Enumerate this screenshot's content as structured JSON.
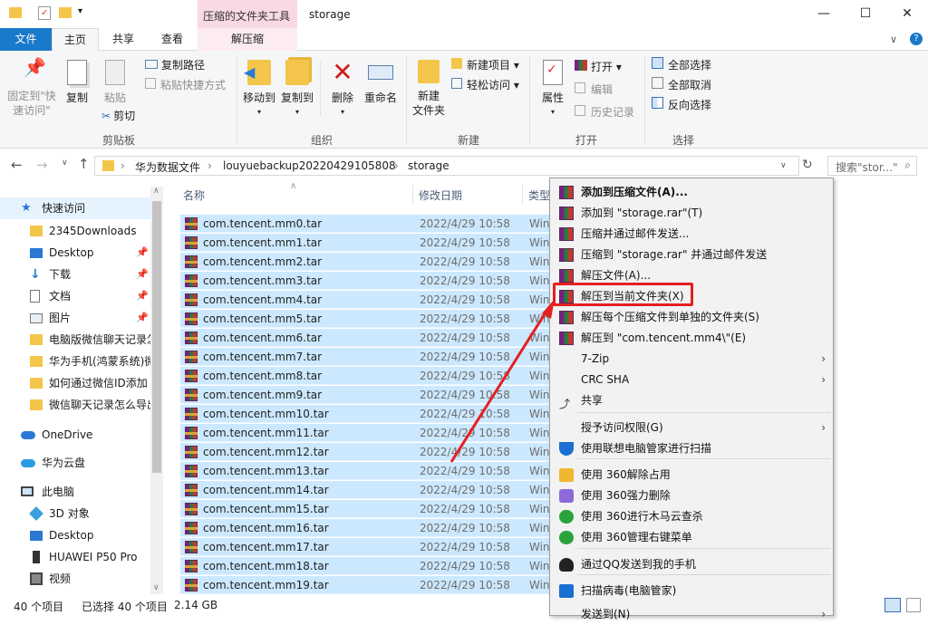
{
  "titlebar": {
    "context_tab": "压缩的文件夹工具",
    "title": "storage"
  },
  "tabs": {
    "file": "文件",
    "home": "主页",
    "share": "共享",
    "view": "查看",
    "extract": "解压缩"
  },
  "ribbon": {
    "pin": "固定到\"快速访问\"",
    "copy": "复制",
    "paste": "粘贴",
    "copy_path": "复制路径",
    "paste_shortcut": "粘贴快捷方式",
    "cut": "剪切",
    "clipboard": "剪贴板",
    "move_to": "移动到",
    "copy_to": "复制到",
    "delete": "删除",
    "rename": "重命名",
    "organize": "组织",
    "new_folder_1": "新建",
    "new_folder_2": "文件夹",
    "new_item": "新建项目",
    "easy_access": "轻松访问",
    "new": "新建",
    "properties": "属性",
    "open": "打开",
    "edit": "编辑",
    "history": "历史记录",
    "open_group": "打开",
    "select_all": "全部选择",
    "select_none": "全部取消",
    "invert": "反向选择",
    "select": "选择"
  },
  "address": {
    "crumbs": [
      "华为数据文件",
      "louyuebackup20220429105808",
      "storage"
    ],
    "search_placeholder": "搜索\"stor...\""
  },
  "nav": {
    "items": [
      {
        "label": "快速访问",
        "icon": "star-icon"
      },
      {
        "label": "2345Downloads",
        "icon": "folder-icon"
      },
      {
        "label": "Desktop",
        "icon": "desktop-icon"
      },
      {
        "label": "下载",
        "icon": "download-icon"
      },
      {
        "label": "文档",
        "icon": "document-icon"
      },
      {
        "label": "图片",
        "icon": "picture-icon"
      },
      {
        "label": "电脑版微信聊天记录怎",
        "icon": "folder-icon"
      },
      {
        "label": "华为手机(鸿蒙系统)微",
        "icon": "folder-icon"
      },
      {
        "label": "如何通过微信ID添加",
        "icon": "folder-icon"
      },
      {
        "label": "微信聊天记录怎么导出",
        "icon": "folder-icon"
      },
      {
        "label": "OneDrive",
        "icon": "cloud-icon"
      },
      {
        "label": "华为云盘",
        "icon": "huawei-cloud-icon"
      },
      {
        "label": "此电脑",
        "icon": "computer-icon"
      },
      {
        "label": "3D 对象",
        "icon": "cube-icon"
      },
      {
        "label": "Desktop",
        "icon": "desktop-icon"
      },
      {
        "label": "HUAWEI P50 Pro",
        "icon": "phone-icon"
      },
      {
        "label": "视频",
        "icon": "video-icon"
      }
    ]
  },
  "columns": {
    "name": "名称",
    "date": "修改日期",
    "type": "类型"
  },
  "files": [
    {
      "name": "com.tencent.mm0.tar",
      "date": "2022/4/29 10:58",
      "type": "Win"
    },
    {
      "name": "com.tencent.mm1.tar",
      "date": "2022/4/29 10:58",
      "type": "Win"
    },
    {
      "name": "com.tencent.mm2.tar",
      "date": "2022/4/29 10:58",
      "type": "Win"
    },
    {
      "name": "com.tencent.mm3.tar",
      "date": "2022/4/29 10:58",
      "type": "Win"
    },
    {
      "name": "com.tencent.mm4.tar",
      "date": "2022/4/29 10:58",
      "type": "Win"
    },
    {
      "name": "com.tencent.mm5.tar",
      "date": "2022/4/29 10:58",
      "type": "Win"
    },
    {
      "name": "com.tencent.mm6.tar",
      "date": "2022/4/29 10:58",
      "type": "Win"
    },
    {
      "name": "com.tencent.mm7.tar",
      "date": "2022/4/29 10:58",
      "type": "Win"
    },
    {
      "name": "com.tencent.mm8.tar",
      "date": "2022/4/29 10:58",
      "type": "Win"
    },
    {
      "name": "com.tencent.mm9.tar",
      "date": "2022/4/29 10:58",
      "type": "Win"
    },
    {
      "name": "com.tencent.mm10.tar",
      "date": "2022/4/29 10:58",
      "type": "Win"
    },
    {
      "name": "com.tencent.mm11.tar",
      "date": "2022/4/29 10:58",
      "type": "Win"
    },
    {
      "name": "com.tencent.mm12.tar",
      "date": "2022/4/29 10:58",
      "type": "Win"
    },
    {
      "name": "com.tencent.mm13.tar",
      "date": "2022/4/29 10:58",
      "type": "Win"
    },
    {
      "name": "com.tencent.mm14.tar",
      "date": "2022/4/29 10:58",
      "type": "Win"
    },
    {
      "name": "com.tencent.mm15.tar",
      "date": "2022/4/29 10:58",
      "type": "Win"
    },
    {
      "name": "com.tencent.mm16.tar",
      "date": "2022/4/29 10:58",
      "type": "Win"
    },
    {
      "name": "com.tencent.mm17.tar",
      "date": "2022/4/29 10:58",
      "type": "Win"
    },
    {
      "name": "com.tencent.mm18.tar",
      "date": "2022/4/29 10:58",
      "type": "Win"
    },
    {
      "name": "com.tencent.mm19.tar",
      "date": "2022/4/29 10:58",
      "type": "Win"
    }
  ],
  "status": {
    "count": "40 个项目",
    "selected": "已选择 40 个项目",
    "size": "2.14 GB"
  },
  "menu": [
    {
      "label": "添加到压缩文件(A)...",
      "icon": "winrar-icon",
      "bold": true
    },
    {
      "label": "添加到 \"storage.rar\"(T)",
      "icon": "winrar-icon"
    },
    {
      "label": "压缩并通过邮件发送...",
      "icon": "winrar-icon"
    },
    {
      "label": "压缩到 \"storage.rar\" 并通过邮件发送",
      "icon": "winrar-icon"
    },
    {
      "label": "解压文件(A)...",
      "icon": "winrar-icon"
    },
    {
      "label": "解压到当前文件夹(X)",
      "icon": "winrar-icon"
    },
    {
      "label": "解压每个压缩文件到单独的文件夹(S)",
      "icon": "winrar-icon"
    },
    {
      "label": "解压到 \"com.tencent.mm4\\\"(E)",
      "icon": "winrar-icon"
    },
    {
      "label": "7-Zip",
      "icon": "",
      "sub": true
    },
    {
      "label": "CRC SHA",
      "icon": "",
      "sub": true
    },
    {
      "label": "共享",
      "icon": "share-icon"
    },
    {
      "label": "授予访问权限(G)",
      "icon": "",
      "sub": true
    },
    {
      "label": "使用联想电脑管家进行扫描",
      "icon": "lenovo-shield-icon"
    },
    {
      "label": "使用 360解除占用",
      "icon": "360-unlock-icon"
    },
    {
      "label": "使用 360强力删除",
      "icon": "360-delete-icon"
    },
    {
      "label": "使用 360进行木马云查杀",
      "icon": "360-scan-icon"
    },
    {
      "label": "使用 360管理右键菜单",
      "icon": "360-menu-icon"
    },
    {
      "label": "通过QQ发送到我的手机",
      "icon": "qq-icon"
    },
    {
      "label": "扫描病毒(电脑管家)",
      "icon": "tencent-shield-icon"
    },
    {
      "label": "发送到(N)",
      "icon": "",
      "sub": true
    }
  ],
  "colors": {
    "accent": "#1979ca",
    "selection": "#cce8ff",
    "highlight": "#e52020",
    "context_tab": "#f9d9e6"
  }
}
